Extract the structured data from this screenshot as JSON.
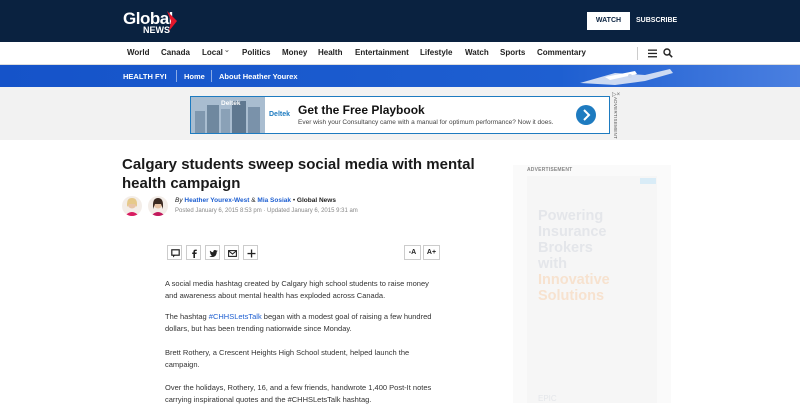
{
  "brand": {
    "line1": "Global",
    "line2": "NEWS"
  },
  "header": {
    "watch_label": "WATCH",
    "subscribe_label": "SUBSCRIBE"
  },
  "nav": {
    "items": [
      "World",
      "Canada",
      "Local",
      "Politics",
      "Money",
      "Health",
      "Entertainment",
      "Lifestyle",
      "Watch",
      "Sports",
      "Commentary"
    ],
    "local_chevron": "⌄"
  },
  "section_bar": {
    "section": "HEALTH FYI",
    "home": "Home",
    "about": "About Heather Yourex"
  },
  "top_ad": {
    "brand_small": "Deltek",
    "brand_main": "Deltek",
    "title": "Get the Free Playbook",
    "subtitle": "Ever wish your Consultancy came with a manual for optimum performance? Now it does.",
    "label": "ADVERTISEMENT",
    "close": "▷×"
  },
  "article": {
    "headline": "Calgary students sweep social media with mental health campaign",
    "by": "By",
    "author1": "Heather Yourex-West",
    "amp": "&",
    "author2": "Mia Sosiak",
    "outlet_sep": "•",
    "outlet": "Global News",
    "posted": "Posted January 6, 2015 8:53 pm · Updated January 6, 2015 9:31 am",
    "font_decrease": "-A",
    "font_increase": "A+",
    "p1": "A social media hashtag created by Calgary high school students to raise money and awareness about mental health has exploded across Canada.",
    "p2_pre": "The hashtag ",
    "p2_tag": "#CHHSLetsTalk",
    "p2_post": " began with a modest goal of raising a few hundred dollars, but has been trending nationwide since Monday.",
    "p3": "Brett Rothery, a Crescent Heights High School student, helped launch the campaign.",
    "p4": "Over the holidays, Rothery, 16, and a few friends, handwrote 1,400 Post-It notes carrying inspirational quotes and the #CHHSLetsTalk hashtag."
  },
  "sidebar_ad": {
    "label": "ADVERTISEMENT",
    "line1": "Powering",
    "line2": "Insurance",
    "line3": "Brokers",
    "line4": "with",
    "line5": "Innovative",
    "line6": "Solutions",
    "bottom": "EPIC"
  },
  "colors": {
    "topbar": "#0a2240",
    "section_bar": "#1e5fd1",
    "link": "#1e5fd1",
    "accent_red": "#e4172b"
  }
}
